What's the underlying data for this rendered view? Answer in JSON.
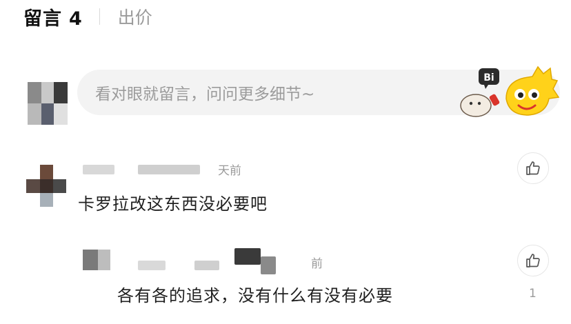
{
  "header": {
    "active_tab": "留言",
    "active_count": "4",
    "inactive_tab": "出价"
  },
  "composer": {
    "placeholder": "看对眼就留言，问问更多细节~",
    "mascot_badge": "Bi"
  },
  "comments": [
    {
      "time_suffix": "天前",
      "text": "卡罗拉改这东西没必要吧",
      "like_icon": "thumbs-up-icon"
    }
  ],
  "replies": [
    {
      "time_suffix": "前",
      "text": "各有各的追求，没有什么有没有必要",
      "like_icon": "thumbs-up-icon",
      "like_count": "1"
    }
  ]
}
